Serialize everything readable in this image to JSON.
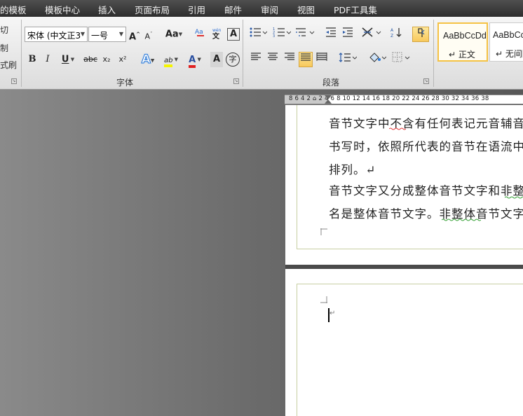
{
  "menu": {
    "items": [
      "的模板",
      "模板中心",
      "插入",
      "页面布局",
      "引用",
      "邮件",
      "审阅",
      "视图",
      "PDF工具集"
    ]
  },
  "clipboard": {
    "cut": "切",
    "copy": "制",
    "format_painter": "式刷"
  },
  "font": {
    "name": "宋体 (中文正3",
    "size": "一号",
    "group_label": "字体",
    "buttons": {
      "grow": "A",
      "shrink": "A",
      "case": "Aa",
      "clear": "A",
      "phonetic": "文",
      "border": "A",
      "bold": "B",
      "italic": "I",
      "underline": "U",
      "strike": "abc",
      "subscript": "x₂",
      "superscript": "x²",
      "effects": "A",
      "highlight": "ab",
      "color": "A",
      "shade": "A",
      "enclose": "字"
    }
  },
  "paragraph": {
    "group_label": "段落"
  },
  "styles": {
    "items": [
      {
        "sample": "AaBbCcDd",
        "name": "↵ 正文"
      },
      {
        "sample": "AaBbCc",
        "name": "↵ 无间隔"
      }
    ]
  },
  "ruler": {
    "numbers": "8  6  4  2  ⌂  2  4  6  8  10 12 14 16 18 20 22 24 26 28 30 32 34 36 38"
  },
  "document": {
    "lines": [
      "音节文字中不含有任何表记元音辅音",
      "书写时，依照所代表的音节在语流中",
      "排列。↵",
      "音节文字又分成整体音节文字和非整",
      "名是整体音节文字。非整体音节文字"
    ],
    "para_mark": "↵"
  },
  "colors": {
    "menubar": "#3a3a3a",
    "ribbon": "#e8e8e8",
    "accent": "#f5c244",
    "doc_bg": "#6b6b6b"
  }
}
